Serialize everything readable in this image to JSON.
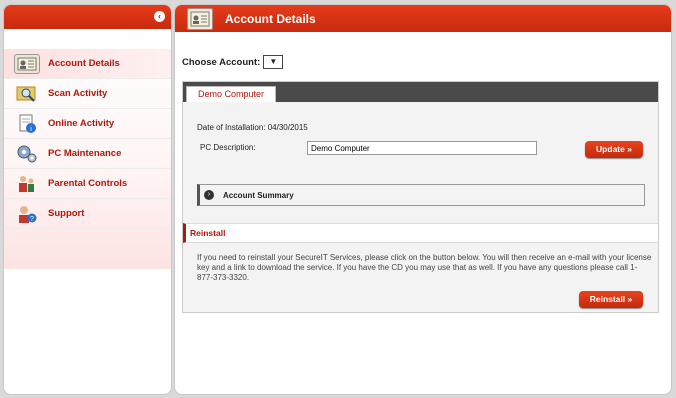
{
  "sidebar": {
    "collapse_glyph": "‹",
    "items": [
      {
        "label": "Account Details",
        "icon": "id-card-icon",
        "active": true
      },
      {
        "label": "Scan Activity",
        "icon": "magnifier-icon",
        "active": false
      },
      {
        "label": "Online Activity",
        "icon": "document-info-icon",
        "active": false
      },
      {
        "label": "PC Maintenance",
        "icon": "gears-icon",
        "active": false
      },
      {
        "label": "Parental Controls",
        "icon": "family-icon",
        "active": false
      },
      {
        "label": "Support",
        "icon": "support-person-icon",
        "active": false
      }
    ]
  },
  "main": {
    "title": "Account Details",
    "choose_account_label": "Choose Account:",
    "account_select_glyph": "▼",
    "tab_label": "Demo Computer",
    "installation_label": "Date of Installation:",
    "installation_date": "04/30/2015",
    "pc_description_label": "PC Description:",
    "pc_description_value": "Demo Computer",
    "update_button": "Update »",
    "summary_toggle_glyph": "›",
    "summary_label": "Account Summary",
    "reinstall_header": "Reinstall",
    "reinstall_text": "If you need to reinstall your SecureIT Services, please click on the button below. You will then receive an e-mail with your license key and a link to download the service. If you have the CD you may use that as well. If you have any questions please call 1-877-373-3320.",
    "reinstall_button": "Reinstall »"
  },
  "colors": {
    "accent_red": "#c82a0e",
    "label_red": "#b3170b",
    "tab_bar": "#4a4a4a"
  }
}
